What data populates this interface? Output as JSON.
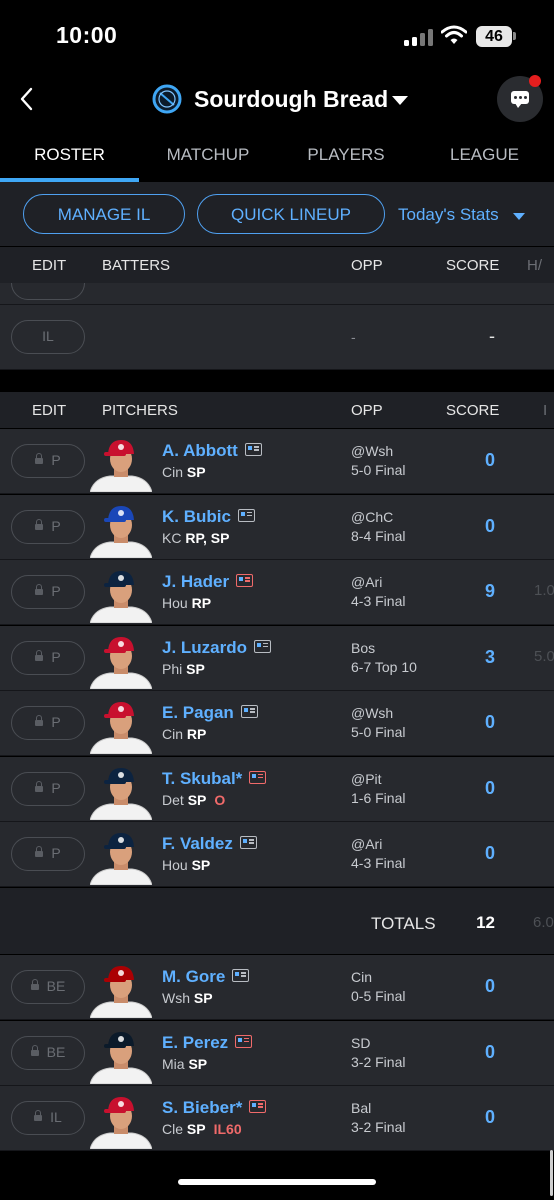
{
  "status_bar": {
    "time": "10:00",
    "battery": "46"
  },
  "header": {
    "team_name": "Sourdough Bread"
  },
  "tabs": [
    {
      "label": "ROSTER"
    },
    {
      "label": "MATCHUP"
    },
    {
      "label": "PLAYERS"
    },
    {
      "label": "LEAGUE"
    }
  ],
  "actions": {
    "manage_il": "MANAGE IL",
    "quick_lineup": "QUICK LINEUP",
    "stats_filter": "Today's Stats"
  },
  "batters": {
    "headers": {
      "edit": "EDIT",
      "section": "BATTERS",
      "opp": "OPP",
      "score": "SCORE",
      "extra": "H/"
    },
    "rows": [
      {
        "slot": "IL",
        "opp": "-",
        "score": "-"
      }
    ]
  },
  "pitchers": {
    "headers": {
      "edit": "EDIT",
      "section": "PITCHERS",
      "opp": "OPP",
      "score": "SCORE",
      "extra": "I"
    },
    "rows": [
      {
        "slot": "P",
        "name": "A. Abbott",
        "team": "Cin",
        "pos": "SP",
        "tag": "",
        "opp": "@Wsh",
        "result": "5-0 Final",
        "score": "0",
        "extra": ""
      },
      {
        "slot": "P",
        "name": "K. Bubic",
        "team": "KC",
        "pos": "RP, SP",
        "tag": "",
        "opp": "@ChC",
        "result": "8-4 Final",
        "score": "0",
        "extra": ""
      },
      {
        "slot": "P",
        "name": "J. Hader",
        "team": "Hou",
        "pos": "RP",
        "tag": "",
        "opp": "@Ari",
        "result": "4-3 Final",
        "score": "9",
        "extra": "1.0"
      },
      {
        "slot": "P",
        "name": "J. Luzardo",
        "team": "Phi",
        "pos": "SP",
        "tag": "",
        "opp": "Bos",
        "result": "6-7 Top 10",
        "score": "3",
        "extra": "5.0"
      },
      {
        "slot": "P",
        "name": "E. Pagan",
        "team": "Cin",
        "pos": "RP",
        "tag": "",
        "opp": "@Wsh",
        "result": "5-0 Final",
        "score": "0",
        "extra": ""
      },
      {
        "slot": "P",
        "name": "T. Skubal*",
        "team": "Det",
        "pos": "SP",
        "tag": "O",
        "opp": "@Pit",
        "result": "1-6 Final",
        "score": "0",
        "extra": ""
      },
      {
        "slot": "P",
        "name": "F. Valdez",
        "team": "Hou",
        "pos": "SP",
        "tag": "",
        "opp": "@Ari",
        "result": "4-3 Final",
        "score": "0",
        "extra": ""
      }
    ],
    "totals": {
      "label": "TOTALS",
      "score": "12",
      "extra": "6.0"
    }
  },
  "bench": {
    "rows": [
      {
        "slot": "BE",
        "name": "M. Gore",
        "team": "Wsh",
        "pos": "SP",
        "tag": "",
        "opp": "Cin",
        "result": "0-5 Final",
        "score": "0"
      },
      {
        "slot": "BE",
        "name": "E. Perez",
        "team": "Mia",
        "pos": "SP",
        "tag": "",
        "opp": "SD",
        "result": "3-2 Final",
        "score": "0"
      },
      {
        "slot": "IL",
        "name": "S. Bieber*",
        "team": "Cle",
        "pos": "SP",
        "tag": "IL60",
        "opp": "Bal",
        "result": "3-2 Final",
        "score": "0"
      }
    ]
  },
  "colors": {
    "accent": "#3fa7f5",
    "link": "#5fb0ff",
    "alert": "#f06a6a",
    "row_bg": "#27292e"
  },
  "icons": [
    "back-chevron-icon",
    "team-logo-icon",
    "chat-icon",
    "news-icon",
    "lock-icon",
    "caret-down-icon"
  ]
}
